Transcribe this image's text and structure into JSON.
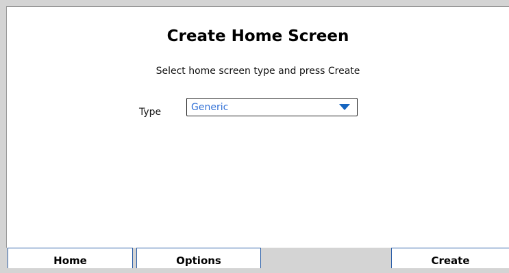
{
  "screen": {
    "title": "Create Home Screen",
    "instruction": "Select home screen type and press Create"
  },
  "form": {
    "type_label": "Type",
    "type_select": {
      "value": "Generic",
      "arrow_icon": "triangle-down-icon"
    }
  },
  "softkeys": {
    "home": "Home",
    "options": "Options",
    "create": "Create"
  },
  "colors": {
    "select_text": "#2f6fd6",
    "select_arrow": "#1565c0",
    "softkey_border": "#2c5fa8",
    "background": "#d4d4d4"
  }
}
